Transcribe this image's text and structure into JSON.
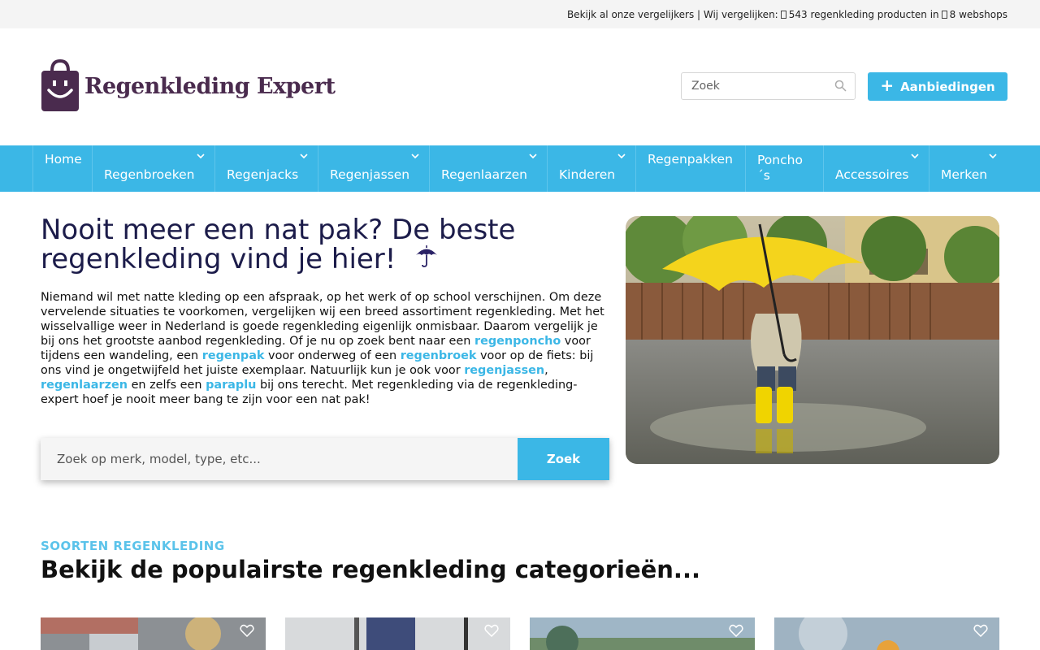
{
  "topbar": {
    "text_prefix": "Bekijk al onze vergelijkers | Wij vergelijken: ",
    "products": "543 regenkleding producten in ",
    "shops": "8 webshops"
  },
  "header": {
    "logo_text": "Regenkleding Expert",
    "search_placeholder": "Zoek",
    "deals_label": "Aanbiedingen"
  },
  "nav": {
    "items": [
      {
        "label": "Home",
        "dropdown": false
      },
      {
        "label": "Regenbroeken",
        "dropdown": true
      },
      {
        "label": "Regenjacks",
        "dropdown": true
      },
      {
        "label": "Regenjassen",
        "dropdown": true
      },
      {
        "label": "Regenlaarzen",
        "dropdown": true
      },
      {
        "label": "Kinderen",
        "dropdown": true
      },
      {
        "label": "Regenpakken",
        "dropdown": false
      },
      {
        "label": "Poncho´s",
        "dropdown": false
      },
      {
        "label": "Accessoires",
        "dropdown": true
      },
      {
        "label": "Merken",
        "dropdown": true
      }
    ]
  },
  "hero": {
    "title": "Nooit meer een nat pak? De beste regenkleding vind je hier!",
    "p1": "Niemand wil met natte kleding op een afspraak, op het werk of op school verschijnen. Om deze vervelende situaties te voorkomen, vergelijken wij een breed assortiment regenkleding. Met het wisselvallige weer in Nederland is goede regenkleding eigenlijk onmisbaar. Daarom vergelijk je bij ons het grootste aanbod regenkleding. Of je nu op zoek bent naar een ",
    "link1": "regenponcho",
    "p2": " voor tijdens een wandeling, een ",
    "link2": "regenpak",
    "p3": " voor onderweg of een ",
    "link3": "regenbroek",
    "p4": " voor op de fiets: bij ons vind je ongetwijfeld het juiste exemplaar. Natuurlijk kun je ook voor ",
    "link4": "regenjassen",
    "p5": ", ",
    "link5": "regenlaarzen",
    "p6": " en zelfs een ",
    "link6": "paraplu",
    "p7": " bij ons terecht. Met regenkleding via de regenkleding-expert hoef je nooit meer bang te zijn voor een nat pak!",
    "search_placeholder": "Zoek op merk, model, type, etc...",
    "search_button": "Zoek"
  },
  "categories": {
    "kicker": "SOORTEN REGENKLEDING",
    "heading_pre": "Bekijk de ",
    "heading_bold": "populairste",
    "heading_post": " regenkleding categorieën..."
  },
  "colors": {
    "accent": "#3bb7e6",
    "brand": "#4a2b4e",
    "title": "#1c1c4a"
  }
}
